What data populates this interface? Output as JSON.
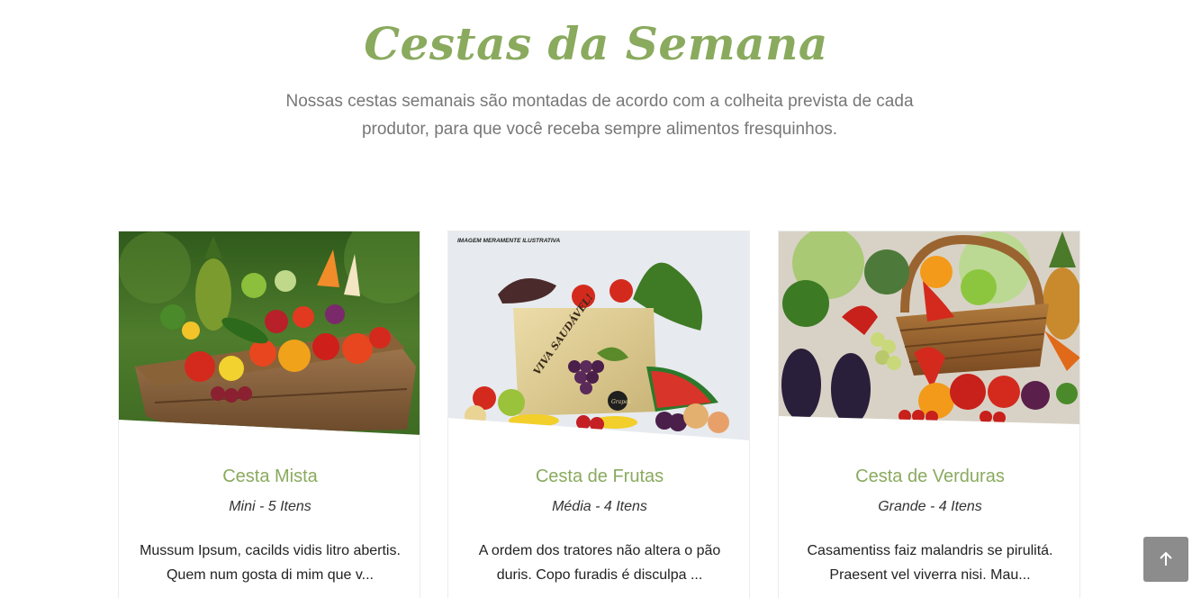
{
  "section": {
    "title": "Cestas da Semana",
    "subtitle": "Nossas cestas semanais são montadas de acordo com a colheita prevista de cada produtor, para que você receba sempre alimentos fresquinhos."
  },
  "cards": [
    {
      "name": "Cesta Mista",
      "size": "Mini - 5 Itens",
      "description": "Mussum Ipsum, cacilds vidis litro abertis. Quem num gosta di mim que v..."
    },
    {
      "name": "Cesta de Frutas",
      "size": "Média - 4 Itens",
      "description": "A ordem dos tratores não altera o pão duris. Copo furadis é disculpa ...",
      "image_label": "IMAGEM MERAMENTE ILUSTRATIVA",
      "bag_text": "VIVA SAUDÁVEL!",
      "bag_brand": "Grapes"
    },
    {
      "name": "Cesta de Verduras",
      "size": "Grande - 4 Itens",
      "description": "Casamentiss faiz malandris se pirulitá. Praesent vel viverra nisi. Mau..."
    }
  ],
  "back_to_top": {
    "icon": "arrow-up-icon"
  },
  "colors": {
    "accent": "#8aaa5e",
    "subtitle": "#777777",
    "button": "#8c8c8c"
  }
}
